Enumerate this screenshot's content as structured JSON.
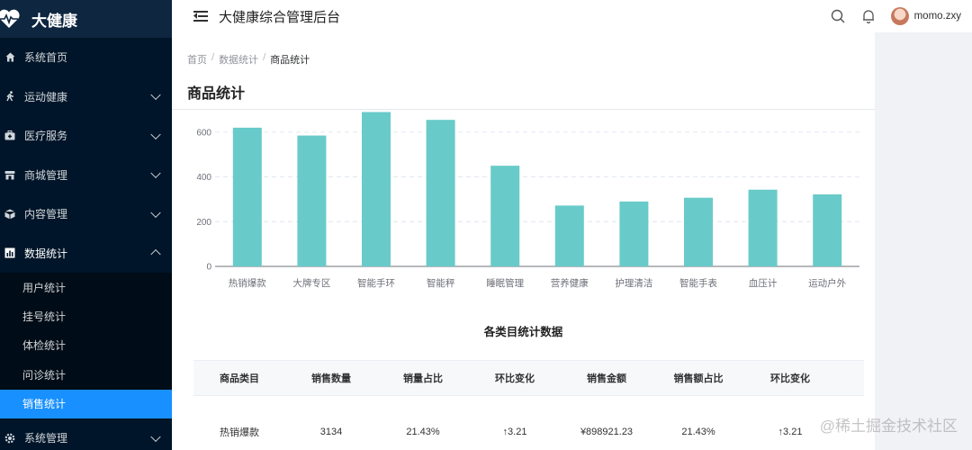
{
  "app": {
    "name": "大健康",
    "header_title": "大健康综合管理后台",
    "username": "momo.zxy"
  },
  "sidebar": {
    "items": [
      {
        "label": "系统首页",
        "icon": "home-icon",
        "expandable": false
      },
      {
        "label": "运动健康",
        "icon": "run-icon",
        "expandable": true
      },
      {
        "label": "医疗服务",
        "icon": "medical-icon",
        "expandable": true
      },
      {
        "label": "商城管理",
        "icon": "shop-icon",
        "expandable": true
      },
      {
        "label": "内容管理",
        "icon": "box-icon",
        "expandable": true
      },
      {
        "label": "数据统计",
        "icon": "chart-icon",
        "expandable": true,
        "open": true
      }
    ],
    "sub_items": [
      {
        "label": "用户统计"
      },
      {
        "label": "挂号统计"
      },
      {
        "label": "体检统计"
      },
      {
        "label": "问诊统计"
      },
      {
        "label": "销售统计",
        "active": true
      }
    ],
    "after": [
      {
        "label": "系统管理",
        "icon": "gear-icon",
        "expandable": true
      }
    ]
  },
  "breadcrumb": [
    "首页",
    "数据统计",
    "商品统计"
  ],
  "page_title": "商品统计",
  "chart_data": {
    "type": "bar",
    "categories": [
      "热销爆款",
      "大牌专区",
      "智能手环",
      "智能秤",
      "睡眠管理",
      "营养健康",
      "护理清洁",
      "智能手表",
      "血压计",
      "运动户外"
    ],
    "values": [
      620,
      585,
      690,
      655,
      450,
      272,
      290,
      307,
      343,
      322
    ],
    "ylim": [
      0,
      700
    ],
    "yticks": [
      0,
      200,
      400,
      600
    ],
    "color": "#68cbc9",
    "grid": true
  },
  "table": {
    "title": "各类目统计数据",
    "headers": [
      "商品类目",
      "销售数量",
      "销量占比",
      "环比变化",
      "销售金额",
      "销售额占比",
      "环比变化"
    ],
    "rows": [
      [
        "热销爆款",
        "3134",
        "21.43%",
        "↑3.21",
        "¥898921.23",
        "21.43%",
        "↑3.21"
      ]
    ]
  },
  "watermark": "@稀土掘金技术社区"
}
